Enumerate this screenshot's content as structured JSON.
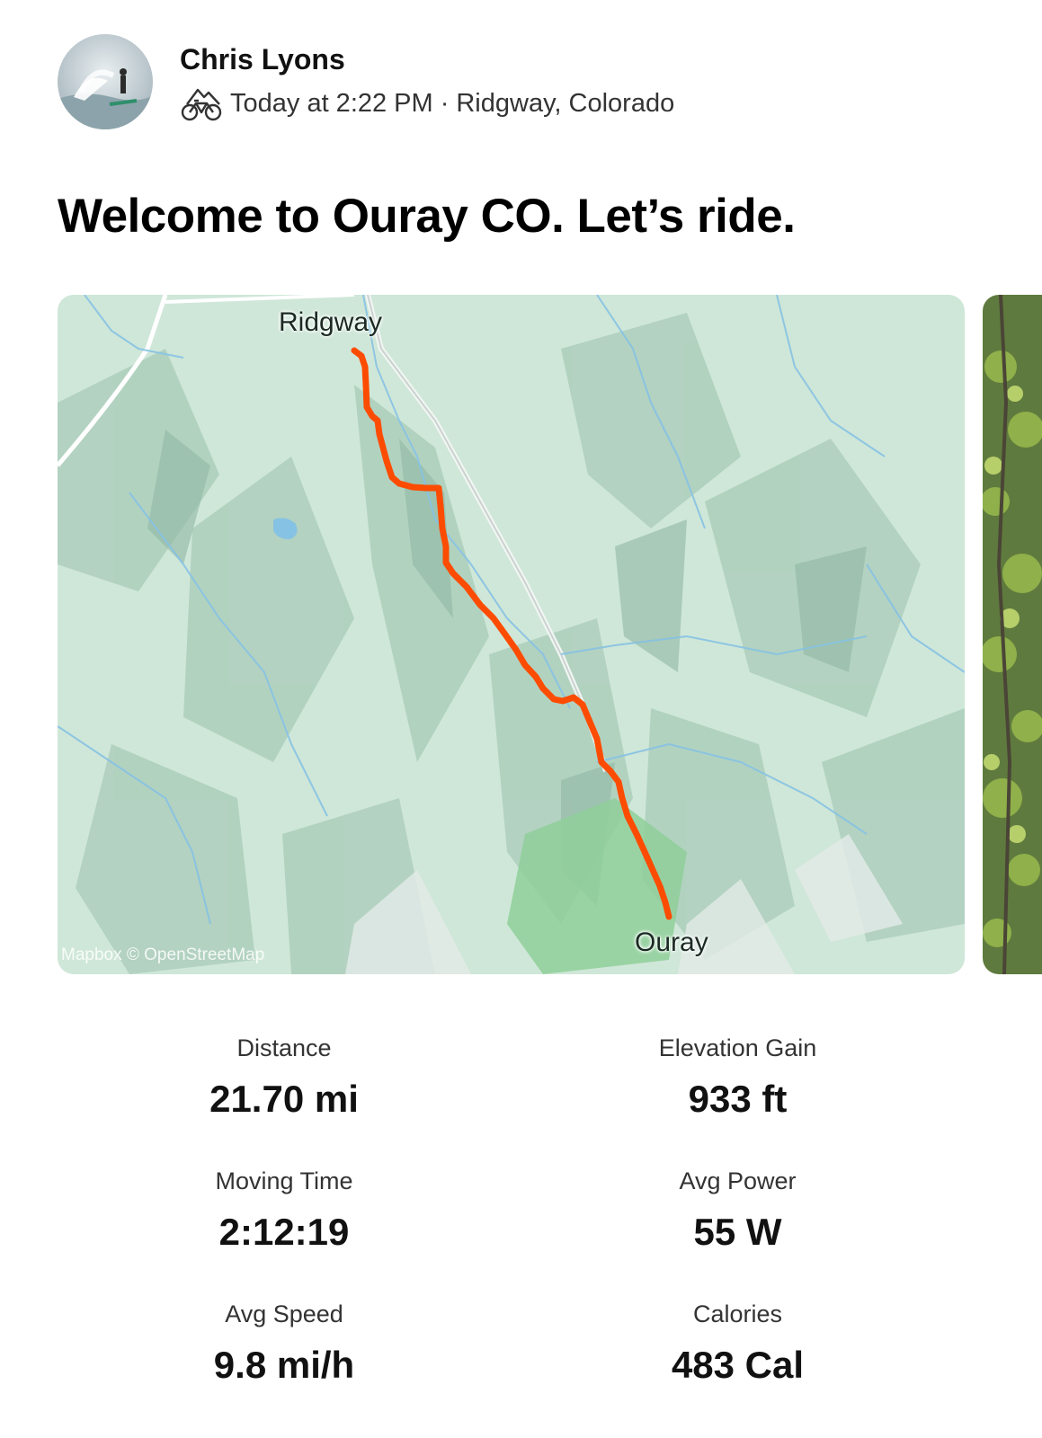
{
  "header": {
    "athlete_name": "Chris Lyons",
    "timestamp": "Today at 2:22 PM",
    "separator": "·",
    "location": "Ridgway, Colorado",
    "activity_icon": "mountain-bike-icon",
    "avatar_icon": "avatar-kitesurfer-photo"
  },
  "activity": {
    "title": "Welcome to Ouray CO. Let’s ride."
  },
  "map": {
    "start_label": "Ridgway",
    "end_label": "Ouray",
    "attribution": "Mapbox © OpenStreetMap",
    "route_color": "#fc4c02",
    "terrain_color": "#cfe7d8"
  },
  "stats": [
    {
      "label": "Distance",
      "value": "21.70 mi"
    },
    {
      "label": "Elevation Gain",
      "value": "933 ft"
    },
    {
      "label": "Moving Time",
      "value": "2:12:19"
    },
    {
      "label": "Avg Power",
      "value": "55 W"
    },
    {
      "label": "Avg Speed",
      "value": "9.8 mi/h"
    },
    {
      "label": "Calories",
      "value": "483 Cal"
    }
  ]
}
